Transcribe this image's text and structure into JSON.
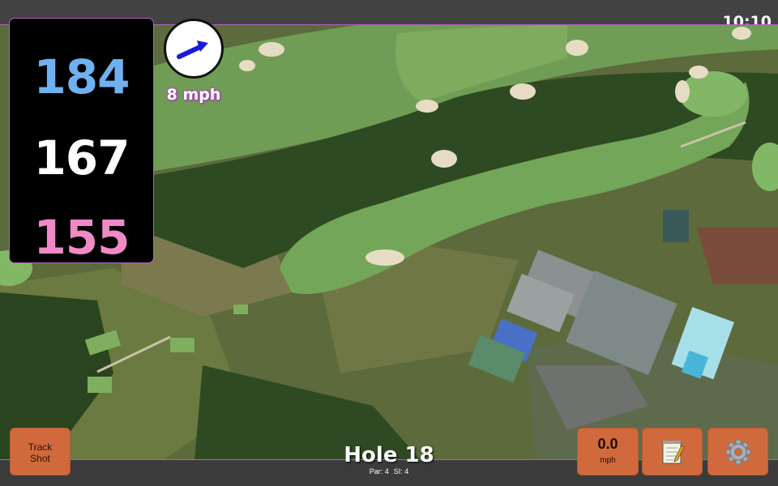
{
  "status": {
    "time": "10:10"
  },
  "distances": {
    "back": "184",
    "middle": "167",
    "front": "155"
  },
  "wind": {
    "speed_label": "8 mph",
    "arrow_icon": "wind-arrow-icon",
    "arrow_color": "#1a1ad8"
  },
  "hole": {
    "title": "Hole 18",
    "par": "Par: 4",
    "stroke_index": "SI: 4"
  },
  "buttons": {
    "track_shot": {
      "line1": "Track",
      "line2": "Shot"
    },
    "shot_speed": {
      "value": "0.0",
      "unit": "mph"
    },
    "notes": {
      "icon": "notepad-icon"
    },
    "settings": {
      "icon": "gear-icon"
    }
  },
  "colors": {
    "accent": "#d06a3c",
    "back_color": "#6fb1f0",
    "front_color": "#f08ac6",
    "panel": "#000000"
  }
}
